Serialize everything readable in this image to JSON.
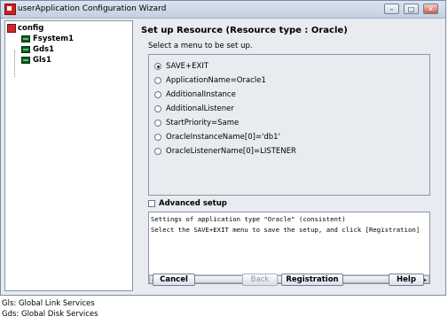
{
  "window": {
    "title": "userApplication Configuration Wizard",
    "controls": {
      "minimize": "–",
      "maximize": "□",
      "close": "✕"
    }
  },
  "tree": {
    "root": "config",
    "children": [
      "Fsystem1",
      "Gds1",
      "Gls1"
    ]
  },
  "panel": {
    "title": "Set up Resource (Resource type : Oracle)",
    "subtitle": "Select a menu to be set up.",
    "options": [
      {
        "label": "SAVE+EXIT",
        "selected": true
      },
      {
        "label": "ApplicationName=Oracle1",
        "selected": false
      },
      {
        "label": "AdditionalInstance",
        "selected": false
      },
      {
        "label": "AdditionalListener",
        "selected": false
      },
      {
        "label": "StartPriority=Same",
        "selected": false
      },
      {
        "label": "OracleInstanceName[0]='db1'",
        "selected": false
      },
      {
        "label": "OracleListenerName[0]=LISTENER",
        "selected": false
      }
    ],
    "advanced_label": "Advanced setup",
    "message_lines": [
      "Settings of application type \"Oracle\" (consistent)",
      "Select the SAVE+EXIT menu to save the setup, and click [Registration]"
    ],
    "scroll": {
      "left": "◀",
      "right": "▶"
    }
  },
  "buttons": {
    "cancel": "Cancel",
    "back": "Back",
    "registration": "Registration",
    "help": "Help"
  },
  "captions": [
    "Gls: Global Link Services",
    "Gds: Global Disk Services"
  ]
}
